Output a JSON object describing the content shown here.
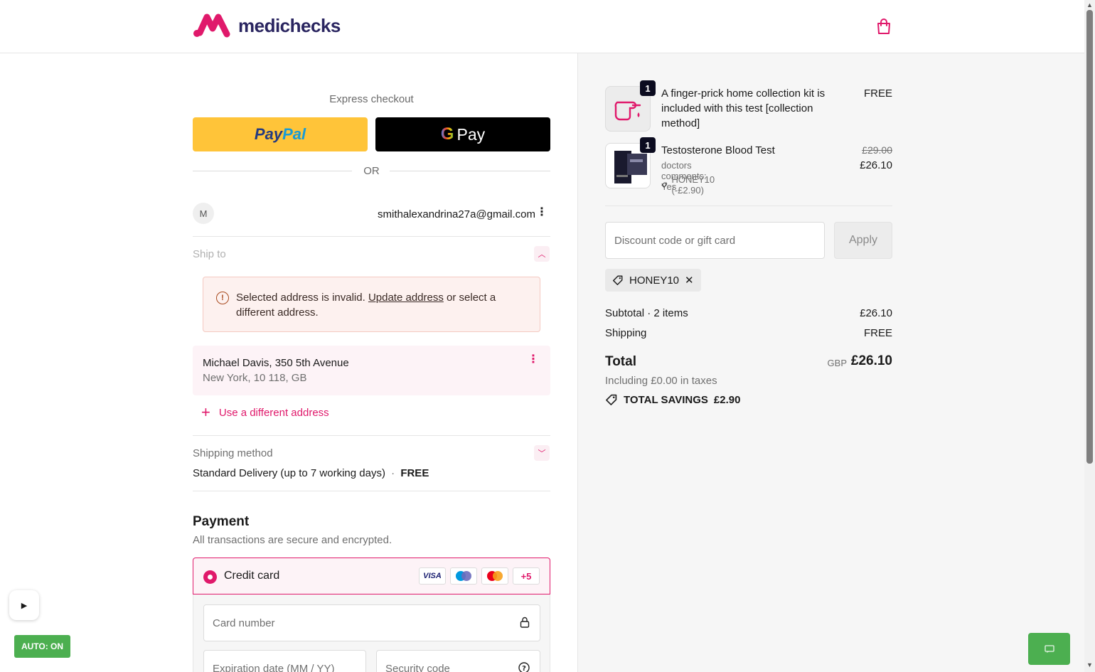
{
  "brand": {
    "name": "medichecks",
    "accent": "#e0196b",
    "navy": "#2a2560"
  },
  "header": {
    "cart_icon": "shopping-bag-icon"
  },
  "express": {
    "title": "Express checkout",
    "paypal_part1": "Pay",
    "paypal_part2": "Pal",
    "gpay_g": "G",
    "gpay_label": "Pay",
    "or_label": "OR"
  },
  "account": {
    "avatar_letter": "M",
    "email": "smithalexandrina27a@gmail.com"
  },
  "ship_to": {
    "label": "Ship to",
    "alert_prefix": "Selected address is invalid.",
    "alert_link": "Update address",
    "alert_suffix": "or select a different address.",
    "address_line1": "Michael Davis, 350 5th Avenue",
    "address_line2": "New York, 10 118, GB",
    "different_address": "Use a different address"
  },
  "shipping_method": {
    "label": "Shipping method",
    "value": "Standard Delivery (up to 7 working days)",
    "separator": "·",
    "price": "FREE"
  },
  "payment": {
    "title": "Payment",
    "subtitle": "All transactions are secure and encrypted.",
    "credit_card_label": "Credit card",
    "card_logos": [
      "VISA",
      "Maestro",
      "Mastercard"
    ],
    "more_cards": "+5",
    "card_number_placeholder": "Card number",
    "expiration_placeholder": "Expiration date (MM / YY)",
    "security_placeholder": "Security code"
  },
  "order": {
    "items": [
      {
        "qty": "1",
        "name": "A finger-prick home collection kit is included with this test [collection method]",
        "price": "FREE"
      },
      {
        "qty": "1",
        "name": "Testosterone Blood Test",
        "sub": "doctors comments: Yes",
        "discount": "HONEY10 (-£2.90)",
        "original_price": "£29.00",
        "price": "£26.10"
      }
    ],
    "discount_placeholder": "Discount code or gift card",
    "apply_label": "Apply",
    "applied_code": "HONEY10",
    "subtotal_label": "Subtotal · 2 items",
    "subtotal_value": "£26.10",
    "shipping_label": "Shipping",
    "shipping_value": "FREE",
    "total_label": "Total",
    "total_currency": "GBP",
    "total_value": "£26.10",
    "tax_line": "Including £0.00 in taxes",
    "savings_label": "TOTAL SAVINGS",
    "savings_value": "£2.90"
  },
  "overlay": {
    "auto_label": "AUTO: ON",
    "play_symbol": "▶"
  }
}
